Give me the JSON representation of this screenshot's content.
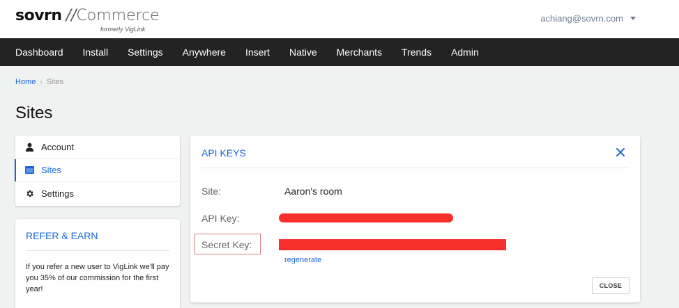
{
  "header": {
    "logo_brand": "sovrn",
    "logo_slash": "//",
    "logo_product": "Commerce",
    "logo_sub": "formerly VigLink",
    "user_email": "achiang@sovrn.com"
  },
  "nav": {
    "items": [
      "Dashboard",
      "Install",
      "Settings",
      "Anywhere",
      "Insert",
      "Native",
      "Merchants",
      "Trends",
      "Admin"
    ]
  },
  "breadcrumb": {
    "home": "Home",
    "separator": "›",
    "current": "Sites"
  },
  "page_title": "Sites",
  "side_menu": {
    "items": [
      {
        "label": "Account",
        "icon": "user-icon"
      },
      {
        "label": "Sites",
        "icon": "browser-window-icon",
        "active": true
      },
      {
        "label": "Settings",
        "icon": "gear-icon"
      }
    ]
  },
  "refer": {
    "title": "REFER & EARN",
    "text": "If you refer a new user to VigLink we'll pay you 35% of our commission for the first year!"
  },
  "api_keys": {
    "title": "API KEYS",
    "site_label": "Site:",
    "site_value": "Aaron's room",
    "api_key_label": "API Key:",
    "secret_key_label": "Secret Key:",
    "regenerate_label": "regenerate",
    "close_label": "CLOSE"
  },
  "colors": {
    "accent": "#1a66d6",
    "nav_bg": "#232323",
    "redaction": "#f7302b",
    "page_bg": "#f0f1f1"
  }
}
